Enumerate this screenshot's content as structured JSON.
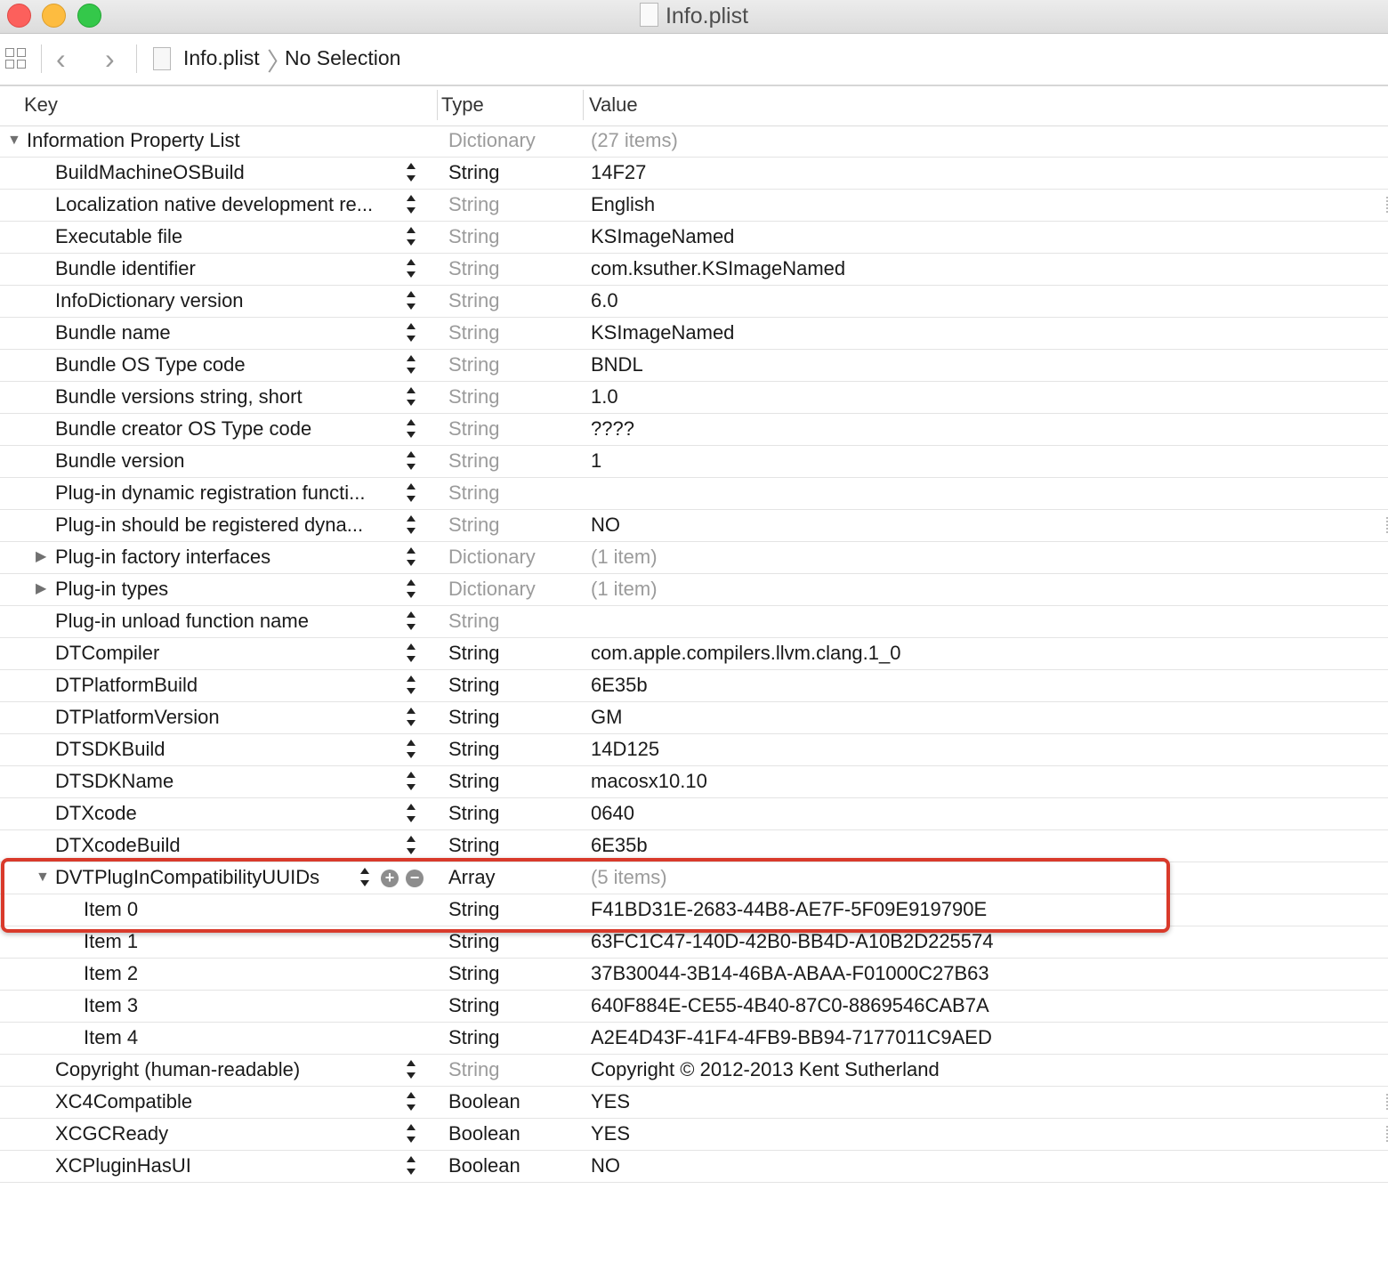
{
  "window": {
    "title": "Info.plist",
    "traffic_lights": {
      "close": "#fc605c",
      "minimize": "#fdbc40",
      "zoom": "#34c84a"
    },
    "title_icon": "plist-file-icon"
  },
  "navbar": {
    "grid_icon": "related-items-grid-icon",
    "back_icon": "chevron-left-icon",
    "forward_icon": "chevron-right-icon",
    "file_icon": "plist-file-icon",
    "breadcrumb_file": "Info.plist",
    "breadcrumb_separator": "〉",
    "breadcrumb_selection": "No Selection"
  },
  "columns": {
    "key": "Key",
    "type": "Type",
    "value": "Value"
  },
  "rows": [
    {
      "key": "Information Property List",
      "type": "Dictionary",
      "value": "(27 items)",
      "level": 0,
      "disclosure": "expanded",
      "type_dim": true,
      "value_dim": true
    },
    {
      "key": "BuildMachineOSBuild",
      "type": "String",
      "value": "14F27",
      "level": 1,
      "type_dim": false
    },
    {
      "key": "Localization native development re...",
      "type": "String",
      "value": "English",
      "level": 1,
      "type_dim": true
    },
    {
      "key": "Executable file",
      "type": "String",
      "value": "KSImageNamed",
      "level": 1,
      "type_dim": true
    },
    {
      "key": "Bundle identifier",
      "type": "String",
      "value": "com.ksuther.KSImageNamed",
      "level": 1,
      "type_dim": true
    },
    {
      "key": "InfoDictionary version",
      "type": "String",
      "value": "6.0",
      "level": 1,
      "type_dim": true
    },
    {
      "key": "Bundle name",
      "type": "String",
      "value": "KSImageNamed",
      "level": 1,
      "type_dim": true
    },
    {
      "key": "Bundle OS Type code",
      "type": "String",
      "value": "BNDL",
      "level": 1,
      "type_dim": true
    },
    {
      "key": "Bundle versions string, short",
      "type": "String",
      "value": "1.0",
      "level": 1,
      "type_dim": true
    },
    {
      "key": "Bundle creator OS Type code",
      "type": "String",
      "value": "????",
      "level": 1,
      "type_dim": true
    },
    {
      "key": "Bundle version",
      "type": "String",
      "value": "1",
      "level": 1,
      "type_dim": true
    },
    {
      "key": "Plug-in dynamic registration functi...",
      "type": "String",
      "value": "",
      "level": 1,
      "type_dim": true
    },
    {
      "key": "Plug-in should be registered dyna...",
      "type": "String",
      "value": "NO",
      "level": 1,
      "type_dim": true
    },
    {
      "key": "Plug-in factory interfaces",
      "type": "Dictionary",
      "value": "(1 item)",
      "level": 1,
      "disclosure": "collapsed",
      "type_dim": true,
      "value_dim": true
    },
    {
      "key": "Plug-in types",
      "type": "Dictionary",
      "value": "(1 item)",
      "level": 1,
      "disclosure": "collapsed",
      "type_dim": true,
      "value_dim": true
    },
    {
      "key": "Plug-in unload function name",
      "type": "String",
      "value": "",
      "level": 1,
      "type_dim": true
    },
    {
      "key": "DTCompiler",
      "type": "String",
      "value": "com.apple.compilers.llvm.clang.1_0",
      "level": 1,
      "type_dim": false
    },
    {
      "key": "DTPlatformBuild",
      "type": "String",
      "value": "6E35b",
      "level": 1,
      "type_dim": false
    },
    {
      "key": "DTPlatformVersion",
      "type": "String",
      "value": "GM",
      "level": 1,
      "type_dim": false
    },
    {
      "key": "DTSDKBuild",
      "type": "String",
      "value": "14D125",
      "level": 1,
      "type_dim": false
    },
    {
      "key": "DTSDKName",
      "type": "String",
      "value": "macosx10.10",
      "level": 1,
      "type_dim": false
    },
    {
      "key": "DTXcode",
      "type": "String",
      "value": "0640",
      "level": 1,
      "type_dim": false
    },
    {
      "key": "DTXcodeBuild",
      "type": "String",
      "value": "6E35b",
      "level": 1,
      "type_dim": false
    },
    {
      "key": "DVTPlugInCompatibilityUUIDs",
      "type": "Array",
      "value": "(5 items)",
      "level": 1,
      "disclosure": "expanded",
      "type_dim": false,
      "value_dim": true,
      "add_remove": true
    },
    {
      "key": "Item 0",
      "type": "String",
      "value": "F41BD31E-2683-44B8-AE7F-5F09E919790E",
      "level": 2,
      "type_dim": false
    },
    {
      "key": "Item 1",
      "type": "String",
      "value": "63FC1C47-140D-42B0-BB4D-A10B2D225574",
      "level": 2,
      "type_dim": false
    },
    {
      "key": "Item 2",
      "type": "String",
      "value": "37B30044-3B14-46BA-ABAA-F01000C27B63",
      "level": 2,
      "type_dim": false
    },
    {
      "key": "Item 3",
      "type": "String",
      "value": "640F884E-CE55-4B40-87C0-8869546CAB7A",
      "level": 2,
      "type_dim": false
    },
    {
      "key": "Item 4",
      "type": "String",
      "value": "A2E4D43F-41F4-4FB9-BB94-7177011C9AED",
      "level": 2,
      "type_dim": false
    },
    {
      "key": "Copyright (human-readable)",
      "type": "String",
      "value": "Copyright © 2012-2013 Kent Sutherland",
      "level": 1,
      "type_dim": true
    },
    {
      "key": "XC4Compatible",
      "type": "Boolean",
      "value": "YES",
      "level": 1,
      "type_dim": false
    },
    {
      "key": "XCGCReady",
      "type": "Boolean",
      "value": "YES",
      "level": 1,
      "type_dim": false
    },
    {
      "key": "XCPluginHasUI",
      "type": "Boolean",
      "value": "NO",
      "level": 1,
      "type_dim": false
    }
  ],
  "annotation": {
    "color": "#d93a2b",
    "label": "highlighted DVTPlugInCompatibilityUUIDs rows"
  }
}
